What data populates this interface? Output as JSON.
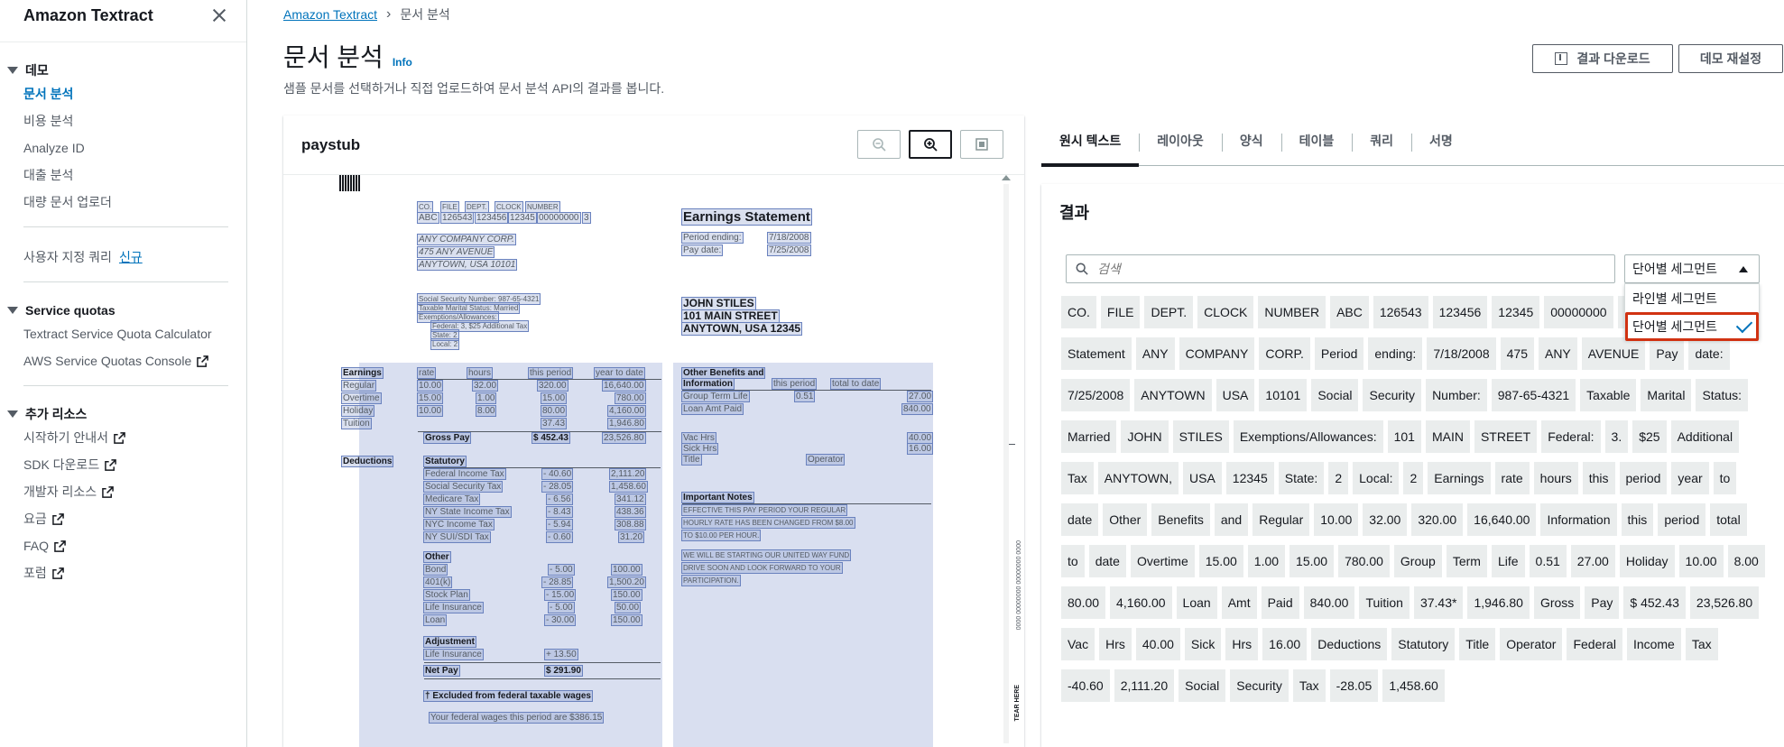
{
  "sidebar": {
    "title": "Amazon Textract",
    "section_demo": {
      "title": "데모",
      "items": [
        {
          "label": "문서 분석",
          "active": true
        },
        {
          "label": "비용 분석",
          "active": false
        },
        {
          "label": "Analyze ID",
          "active": false
        },
        {
          "label": "대출 분석",
          "active": false
        },
        {
          "label": "대량 문서 업로더",
          "active": false
        }
      ]
    },
    "custom_query": {
      "label": "사용자 지정 쿼리",
      "badge": "신규"
    },
    "section_quotas": {
      "title": "Service quotas",
      "items": [
        {
          "label": "Textract Service Quota Calculator",
          "external": false
        },
        {
          "label": "AWS Service Quotas Console",
          "external": true
        }
      ]
    },
    "section_resources": {
      "title": "추가 리소스",
      "items": [
        {
          "label": "시작하기 안내서",
          "external": true
        },
        {
          "label": "SDK 다운로드",
          "external": true
        },
        {
          "label": "개발자 리소스",
          "external": true
        },
        {
          "label": "요금",
          "external": true
        },
        {
          "label": "FAQ",
          "external": true
        },
        {
          "label": "포럼",
          "external": true
        }
      ]
    }
  },
  "header": {
    "breadcrumb": [
      "Amazon Textract",
      "문서 분석"
    ],
    "title": "문서 분석",
    "info": "Info",
    "description": "샘플 문서를 선택하거나 직접 업로드하여 문서 분석 API의 결과를 봅니다.",
    "download_button": "결과 다운로드",
    "reset_button": "데모 재설정"
  },
  "document": {
    "title": "paystub",
    "tools": [
      "zoom-out-icon",
      "zoom-in-icon",
      "fit-page-icon"
    ]
  },
  "paystub": {
    "top_codes_header": [
      "CO.",
      "FILE",
      "DEPT.",
      "CLOCK",
      "NUMBER"
    ],
    "top_codes": [
      "ABC",
      "126543",
      "123456",
      "12345",
      "00000000",
      "3"
    ],
    "company": [
      "ANY COMPANY CORP.",
      "475 ANY AVENUE",
      "ANYTOWN, USA 10101"
    ],
    "statement_title": "Earnings Statement",
    "period_ending_label": "Period ending:",
    "period_ending": "7/18/2008",
    "pay_date_label": "Pay date:",
    "pay_date": "7/25/2008",
    "ssn": "Social Security Number: 987-65-4321",
    "marital": "Taxable Marital Status: Married",
    "exemptions": "Exemptions/Allowances:",
    "federal": "Federal: 3, $25 Additional Tax",
    "state": "State: 2",
    "local": "Local: 2",
    "employee": [
      "JOHN STILES",
      "101 MAIN STREET",
      "ANYTOWN, USA 12345"
    ],
    "earnings_header": [
      "Earnings",
      "rate",
      "hours",
      "this period",
      "year to date"
    ],
    "earnings_rows": [
      [
        "Regular",
        "10.00",
        "32.00",
        "320.00",
        "16,640.00"
      ],
      [
        "Overtime",
        "15.00",
        "1.00",
        "15.00",
        "780.00"
      ],
      [
        "Holiday",
        "10.00",
        "8.00",
        "80.00",
        "4,160.00"
      ],
      [
        "Tuition",
        "",
        "",
        "37.43",
        "1,946.80"
      ]
    ],
    "gross_pay": [
      "Gross Pay",
      "$ 452.43",
      "23,526.80"
    ],
    "deductions_label": "Deductions",
    "statutory_label": "Statutory",
    "statutory_rows": [
      [
        "Federal Income Tax",
        "- 40.60",
        "2,111.20"
      ],
      [
        "Social Security Tax",
        "- 28.05",
        "1,458.60"
      ],
      [
        "Medicare Tax",
        "- 6.56",
        "341.12"
      ],
      [
        "NY State Income Tax",
        "- 8.43",
        "438.36"
      ],
      [
        "NYC Income Tax",
        "- 5.94",
        "308.88"
      ],
      [
        "NY SUI/SDI Tax",
        "- 0.60",
        "31.20"
      ]
    ],
    "other_label": "Other",
    "other_rows": [
      [
        "Bond",
        "- 5.00",
        "100.00"
      ],
      [
        "401(k)",
        "- 28.85",
        "1,500.20"
      ],
      [
        "Stock Plan",
        "- 15.00",
        "150.00"
      ],
      [
        "Life Insurance",
        "- 5.00",
        "50.00"
      ],
      [
        "Loan",
        "- 30.00",
        "150.00"
      ]
    ],
    "adjustment_label": "Adjustment",
    "adjustment_row": [
      "Life Insurance",
      "+ 13.50"
    ],
    "net_pay": [
      "Net Pay",
      "$ 291.90"
    ],
    "excluded_note": "† Excluded from federal taxable wages",
    "wages_note": "Your federal wages this period are $386.15",
    "benefits_header": [
      "Other Benefits and",
      "Information",
      "this period",
      "total to date"
    ],
    "benefits_rows": [
      [
        "Group Term Life",
        "0.51",
        "27.00"
      ],
      [
        "Loan Amt Paid",
        "",
        "840.00"
      ],
      [
        "Vac Hrs",
        "",
        "40.00"
      ],
      [
        "Sick Hrs",
        "",
        "16.00"
      ],
      [
        "Title",
        "Operator",
        ""
      ]
    ],
    "notes_label": "Important Notes",
    "notes_lines": [
      "EFFECTIVE THIS PAY PERIOD YOUR REGULAR",
      "HOURLY RATE HAS BEEN CHANGED FROM $8.00",
      "TO $10.00 PER HOUR.",
      "WE WILL BE STARTING OUR UNITED WAY FUND",
      "DRIVE SOON AND LOOK FORWARD TO YOUR",
      "PARTICIPATION."
    ],
    "tear_here": "TEAR HERE",
    "side_code": "0000 00000000 00000000 0000"
  },
  "results": {
    "tabs": [
      {
        "label": "원시 텍스트",
        "active": true
      },
      {
        "label": "레이아웃",
        "active": false
      },
      {
        "label": "양식",
        "active": false
      },
      {
        "label": "테이블",
        "active": false
      },
      {
        "label": "쿼리",
        "active": false
      },
      {
        "label": "서명",
        "active": false
      }
    ],
    "title": "결과",
    "search_placeholder": "검색",
    "select_value": "단어별 세그먼트",
    "dropdown_options": [
      {
        "label": "라인별 세그먼트",
        "selected": false
      },
      {
        "label": "단어별 세그먼트",
        "selected": true
      }
    ],
    "words": [
      "CO.",
      "FILE",
      "DEPT.",
      "CLOCK",
      "NUMBER",
      "ABC",
      "126543",
      "123456",
      "12345",
      "00000000",
      "3",
      "Earnings",
      "Statement",
      "ANY",
      "COMPANY",
      "CORP.",
      "Period",
      "ending:",
      "7/18/2008",
      "475",
      "ANY",
      "AVENUE",
      "Pay",
      "date:",
      "7/25/2008",
      "ANYTOWN",
      "USA",
      "10101",
      "Social",
      "Security",
      "Number:",
      "987-65-4321",
      "Taxable",
      "Marital",
      "Status:",
      "Married",
      "JOHN",
      "STILES",
      "Exemptions/Allowances:",
      "101",
      "MAIN",
      "STREET",
      "Federal:",
      "3.",
      "$25",
      "Additional",
      "Tax",
      "ANYTOWN,",
      "USA",
      "12345",
      "State:",
      "2",
      "Local:",
      "2",
      "Earnings",
      "rate",
      "hours",
      "this",
      "period",
      "year",
      "to",
      "date",
      "Other",
      "Benefits",
      "and",
      "Regular",
      "10.00",
      "32.00",
      "320.00",
      "16,640.00",
      "Information",
      "this",
      "period",
      "total",
      "to",
      "date",
      "Overtime",
      "15.00",
      "1.00",
      "15.00",
      "780.00",
      "Group",
      "Term",
      "Life",
      "0.51",
      "27.00",
      "Holiday",
      "10.00",
      "8.00",
      "80.00",
      "4,160.00",
      "Loan",
      "Amt",
      "Paid",
      "840.00",
      "Tuition",
      "37.43*",
      "1,946.80",
      "Gross",
      "Pay",
      "$ 452.43",
      "23,526.80",
      "Vac",
      "Hrs",
      "40.00",
      "Sick",
      "Hrs",
      "16.00",
      "Deductions",
      "Statutory",
      "Title",
      "Operator",
      "Federal",
      "Income",
      "Tax",
      "-40.60",
      "2,111.20",
      "Social",
      "Security",
      "Tax",
      "-28.05",
      "1,458.60"
    ]
  }
}
